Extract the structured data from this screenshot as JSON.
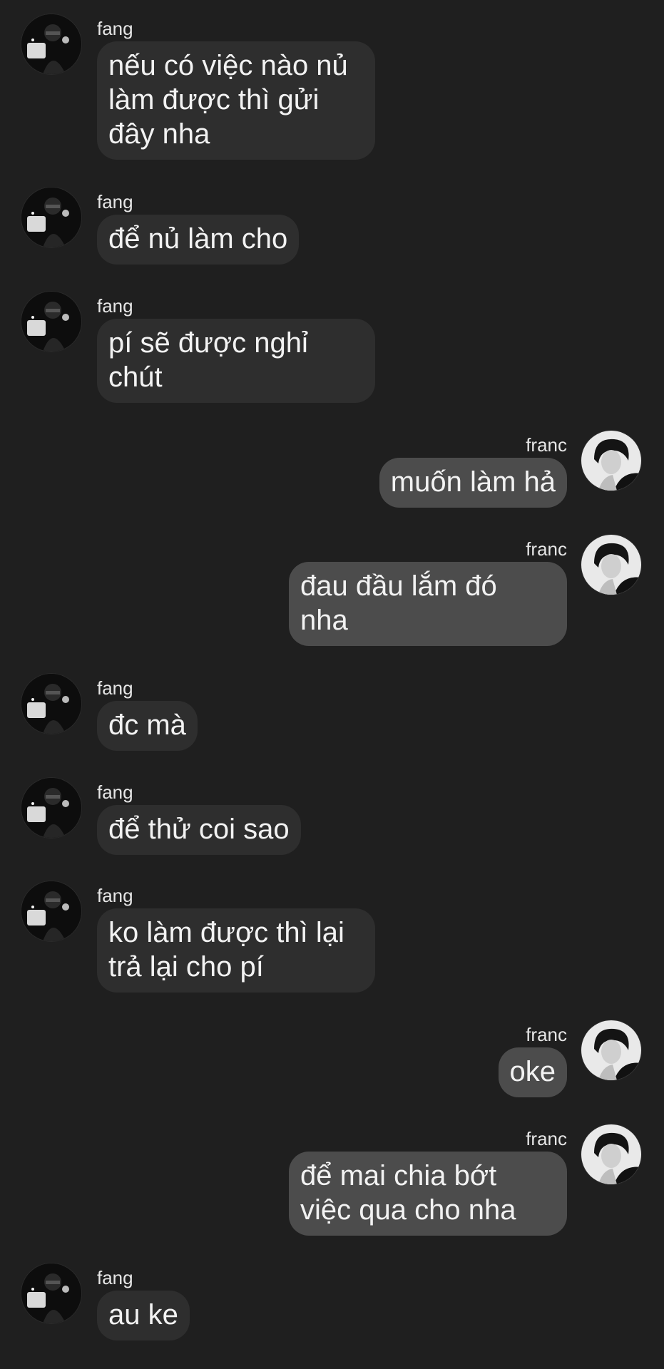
{
  "messages": [
    {
      "sender": "fang",
      "lines": [
        "nếu có việc nào nủ",
        "làm được thì gửi",
        "đây nha"
      ]
    },
    {
      "sender": "fang",
      "lines": [
        "để nủ làm cho"
      ]
    },
    {
      "sender": "fang",
      "lines": [
        "pí sẽ được nghỉ",
        "chút"
      ]
    },
    {
      "sender": "franc",
      "lines": [
        "muốn làm hả"
      ]
    },
    {
      "sender": "franc",
      "lines": [
        "đau đầu lắm đó",
        "nha"
      ]
    },
    {
      "sender": "fang",
      "lines": [
        "đc mà"
      ]
    },
    {
      "sender": "fang",
      "lines": [
        "để thử coi sao"
      ]
    },
    {
      "sender": "fang",
      "lines": [
        "ko làm được thì lại",
        "trả lại cho pí"
      ]
    },
    {
      "sender": "franc",
      "lines": [
        "oke"
      ]
    },
    {
      "sender": "franc",
      "lines": [
        "để mai chia bớt",
        "việc qua cho nha"
      ]
    },
    {
      "sender": "fang",
      "lines": [
        "au ke"
      ]
    }
  ]
}
